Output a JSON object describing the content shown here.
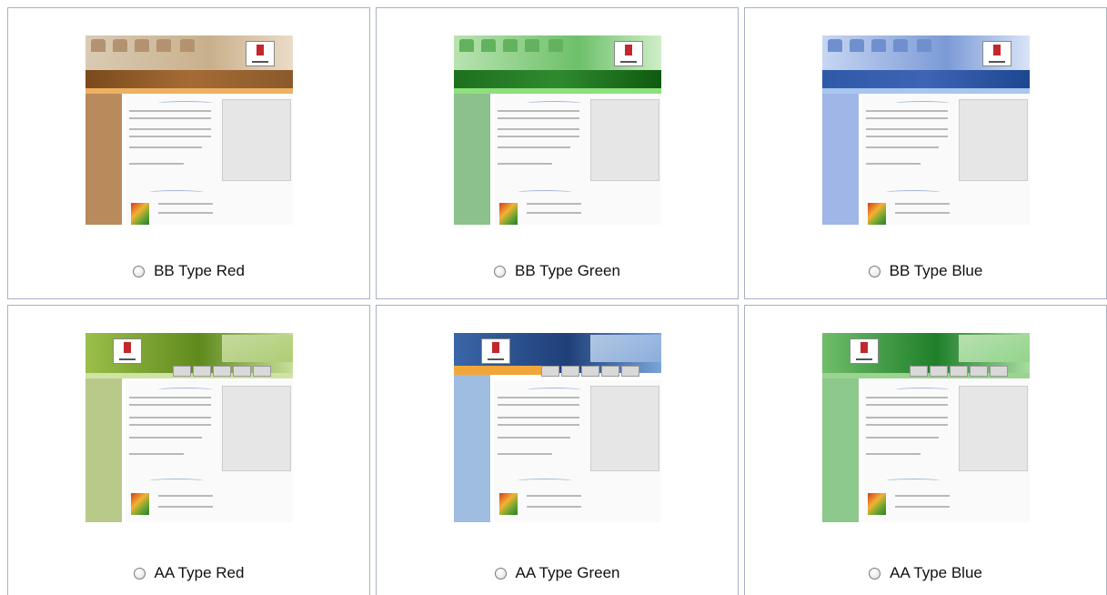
{
  "templates": [
    {
      "label": "BB Type Red",
      "preview_icon": "template-thumbnail",
      "accent": "#b98a5c",
      "header": "#8a5a2c",
      "band": "#f0b061",
      "selected": false
    },
    {
      "label": "BB Type Green",
      "preview_icon": "template-thumbnail",
      "accent": "#8cc08c",
      "header": "#2f8a2f",
      "band": "#8ee07c",
      "selected": false
    },
    {
      "label": "BB Type Blue",
      "preview_icon": "template-thumbnail",
      "accent": "#9fb6e6",
      "header": "#3e64b4",
      "band": "#a9c6f0",
      "selected": false
    },
    {
      "label": "AA Type Red",
      "preview_icon": "template-thumbnail",
      "accent": "#b9c98a",
      "header": "#6e8f1e",
      "band": "#a5c45c",
      "selected": false
    },
    {
      "label": "AA Type Green",
      "preview_icon": "template-thumbnail",
      "accent": "#9fbde0",
      "header": "#2b4f88",
      "band": "#f2a63a",
      "selected": false
    },
    {
      "label": "AA Type Blue",
      "preview_icon": "template-thumbnail",
      "accent": "#8dc88d",
      "header": "#1f7f2a",
      "band": "#9ad48f",
      "selected": false
    }
  ]
}
